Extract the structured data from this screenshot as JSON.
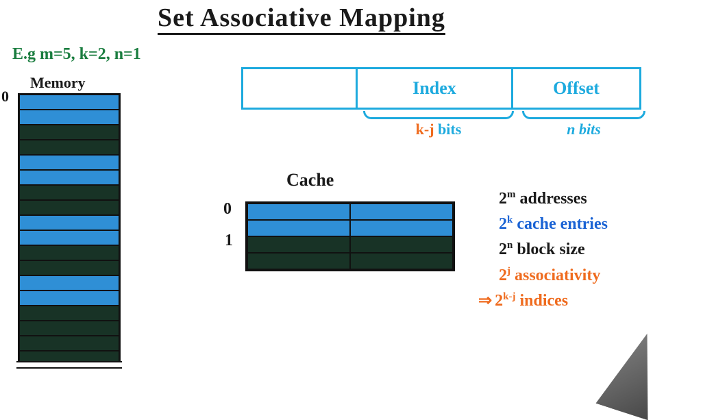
{
  "title": "Set Associative Mapping",
  "example": "E.g m=5, k=2, n=1",
  "memory": {
    "label": "Memory",
    "index0": "0"
  },
  "address_format": {
    "tag": "",
    "index": "Index",
    "offset": "Offset",
    "index_bits_prefix": "k-j",
    "index_bits_suffix": " bits",
    "offset_bits": "n bits"
  },
  "cache": {
    "label": "Cache",
    "index0": "0",
    "index1": "1"
  },
  "notes": {
    "addresses": {
      "base": "2",
      "exp": "m",
      "text": " addresses"
    },
    "entries": {
      "base": "2",
      "exp": "k",
      "text": " cache entries"
    },
    "block": {
      "base": "2",
      "exp": "n",
      "text": " block size"
    },
    "assoc": {
      "base": "2",
      "exp": "j",
      "text": " associativity"
    },
    "indices": {
      "arrow": "⇒",
      "base": "2",
      "exp": "k-j",
      "text": " indices"
    }
  }
}
